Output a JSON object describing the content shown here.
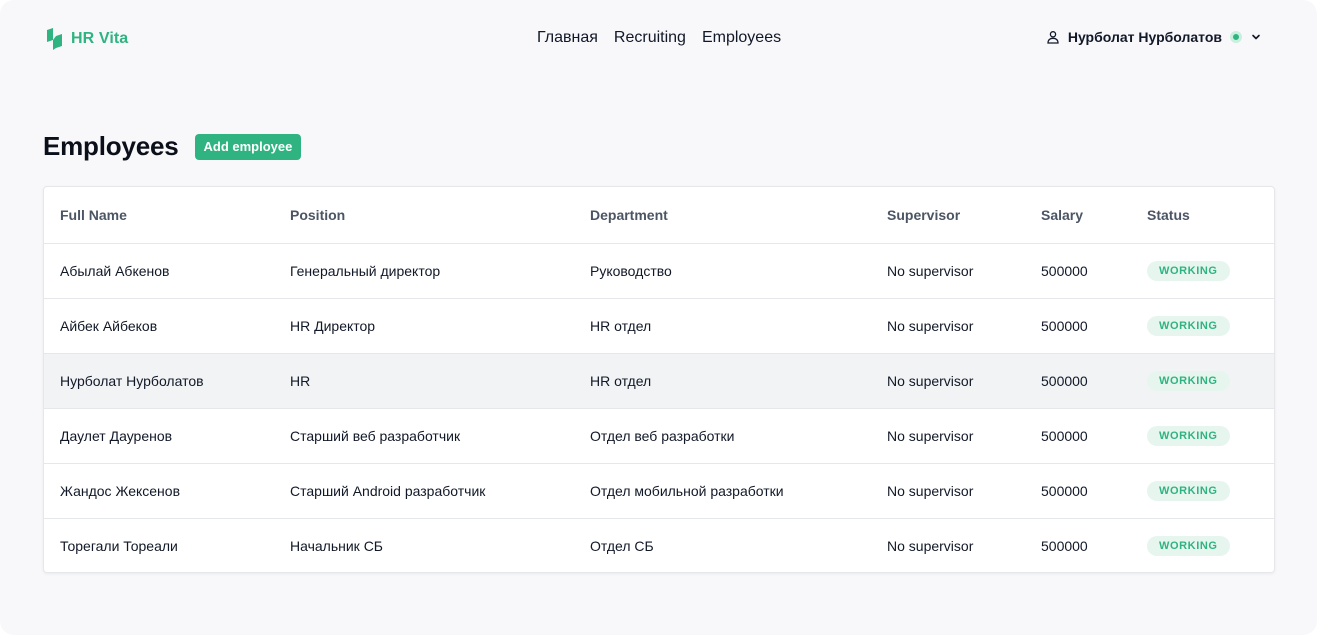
{
  "brand": {
    "name": "HR Vita",
    "color": "#2fb381"
  },
  "nav": {
    "items": [
      "Главная",
      "Recruiting",
      "Employees"
    ]
  },
  "user": {
    "name": "Нурболат Нурболатов",
    "status": "online"
  },
  "page": {
    "title": "Employees",
    "add_label": "Add employee"
  },
  "table": {
    "columns": [
      "Full Name",
      "Position",
      "Department",
      "Supervisor",
      "Salary",
      "Status"
    ],
    "rows": [
      [
        "Абылай Абкенов",
        "Генеральный директор",
        "Руководство",
        "No supervisor",
        "500000",
        "WORKING"
      ],
      [
        "Айбек Айбеков",
        "HR Директор",
        "HR отдел",
        "No supervisor",
        "500000",
        "WORKING"
      ],
      [
        "Нурболат Нурболатов",
        "HR",
        "HR отдел",
        "No supervisor",
        "500000",
        "WORKING"
      ],
      [
        "Даулет Дауренов",
        "Старший веб разработчик",
        "Отдел веб разработки",
        "No supervisor",
        "500000",
        "WORKING"
      ],
      [
        "Жандос Жексенов",
        "Старший Android разработчик",
        "Отдел мобильной разработки",
        "No supervisor",
        "500000",
        "WORKING"
      ],
      [
        "Торегали Тореали",
        "Начальник СБ",
        "Отдел СБ",
        "No supervisor",
        "500000",
        "WORKING"
      ]
    ]
  },
  "icons": {
    "logo": "bolt-logo-icon",
    "user": "user-icon",
    "caret": "chevron-down-icon"
  }
}
